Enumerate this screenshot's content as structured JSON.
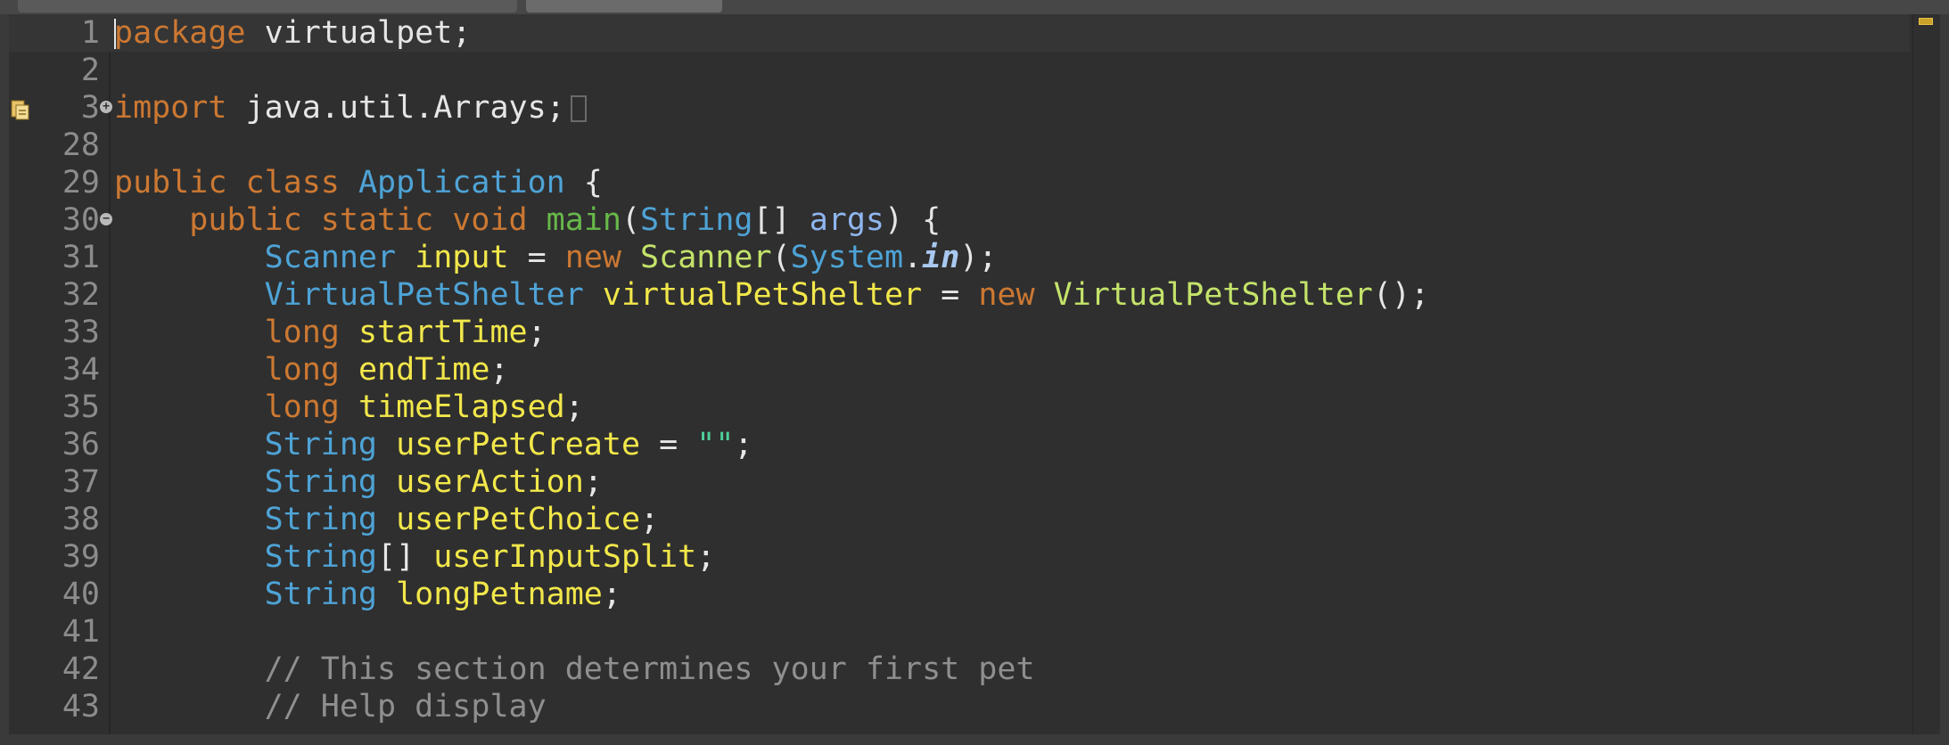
{
  "editor": {
    "lines": [
      {
        "n": "1",
        "tokens": [
          [
            "kw",
            "package"
          ],
          [
            "plain",
            " virtualpet;"
          ]
        ],
        "current": true,
        "caret": true
      },
      {
        "n": "2",
        "tokens": []
      },
      {
        "n": "3",
        "fold": "+",
        "tokens": [
          [
            "kw",
            "import"
          ],
          [
            "plain",
            " java.util.Arrays;"
          ]
        ],
        "collapsed": true
      },
      {
        "n": "28",
        "tokens": []
      },
      {
        "n": "29",
        "tokens": [
          [
            "kw",
            "public class "
          ],
          [
            "typ",
            "Application"
          ],
          [
            "plain",
            " {"
          ]
        ]
      },
      {
        "n": "30",
        "fold": "-",
        "tokens": [
          [
            "plain",
            "    "
          ],
          [
            "kw",
            "public static void "
          ],
          [
            "fn",
            "main"
          ],
          [
            "plain",
            "("
          ],
          [
            "typ",
            "String"
          ],
          [
            "plain",
            "[] "
          ],
          [
            "param",
            "args"
          ],
          [
            "plain",
            ") {"
          ]
        ]
      },
      {
        "n": "31",
        "tokens": [
          [
            "plain",
            "        "
          ],
          [
            "typ",
            "Scanner"
          ],
          [
            "var",
            " input"
          ],
          [
            "plain",
            " = "
          ],
          [
            "kw",
            "new "
          ],
          [
            "ctor",
            "Scanner"
          ],
          [
            "plain",
            "("
          ],
          [
            "typ",
            "System"
          ],
          [
            "plain",
            "."
          ],
          [
            "static",
            "in"
          ],
          [
            "plain",
            ");"
          ]
        ]
      },
      {
        "n": "32",
        "tokens": [
          [
            "plain",
            "        "
          ],
          [
            "typ",
            "VirtualPetShelter"
          ],
          [
            "var",
            " virtualPetShelter"
          ],
          [
            "plain",
            " = "
          ],
          [
            "kw",
            "new "
          ],
          [
            "ctor",
            "VirtualPetShelter"
          ],
          [
            "plain",
            "();"
          ]
        ]
      },
      {
        "n": "33",
        "tokens": [
          [
            "plain",
            "        "
          ],
          [
            "kw",
            "long"
          ],
          [
            "var",
            " startTime"
          ],
          [
            "plain",
            ";"
          ]
        ]
      },
      {
        "n": "34",
        "tokens": [
          [
            "plain",
            "        "
          ],
          [
            "kw",
            "long"
          ],
          [
            "var",
            " endTime"
          ],
          [
            "plain",
            ";"
          ]
        ]
      },
      {
        "n": "35",
        "tokens": [
          [
            "plain",
            "        "
          ],
          [
            "kw",
            "long"
          ],
          [
            "var",
            " timeElapsed"
          ],
          [
            "plain",
            ";"
          ]
        ]
      },
      {
        "n": "36",
        "tokens": [
          [
            "plain",
            "        "
          ],
          [
            "typ",
            "String"
          ],
          [
            "var",
            " userPetCreate"
          ],
          [
            "plain",
            " = "
          ],
          [
            "str",
            "\"\""
          ],
          [
            "plain",
            ";"
          ]
        ]
      },
      {
        "n": "37",
        "tokens": [
          [
            "plain",
            "        "
          ],
          [
            "typ",
            "String"
          ],
          [
            "var",
            " userAction"
          ],
          [
            "plain",
            ";"
          ]
        ]
      },
      {
        "n": "38",
        "tokens": [
          [
            "plain",
            "        "
          ],
          [
            "typ",
            "String"
          ],
          [
            "var",
            " userPetChoice"
          ],
          [
            "plain",
            ";"
          ]
        ]
      },
      {
        "n": "39",
        "tokens": [
          [
            "plain",
            "        "
          ],
          [
            "typ",
            "String"
          ],
          [
            "plain",
            "[] "
          ],
          [
            "var",
            "userInputSplit"
          ],
          [
            "plain",
            ";"
          ]
        ]
      },
      {
        "n": "40",
        "tokens": [
          [
            "plain",
            "        "
          ],
          [
            "typ",
            "String"
          ],
          [
            "var",
            " longPetname"
          ],
          [
            "plain",
            ";"
          ]
        ]
      },
      {
        "n": "41",
        "tokens": []
      },
      {
        "n": "42",
        "tokens": [
          [
            "plain",
            "        "
          ],
          [
            "cmt",
            "// This section determines your first pet"
          ]
        ]
      },
      {
        "n": "43",
        "tokens": [
          [
            "plain",
            "        "
          ],
          [
            "cmt",
            "// Help display"
          ]
        ]
      }
    ]
  },
  "icons": {
    "occurrence_marker": "occurrence-marker-icon",
    "import_warning": "import-warning-icon",
    "fold_expand": "fold-expand-icon",
    "fold_collapse": "fold-collapse-icon",
    "overview_warning": "overview-ruler-warning-icon"
  }
}
